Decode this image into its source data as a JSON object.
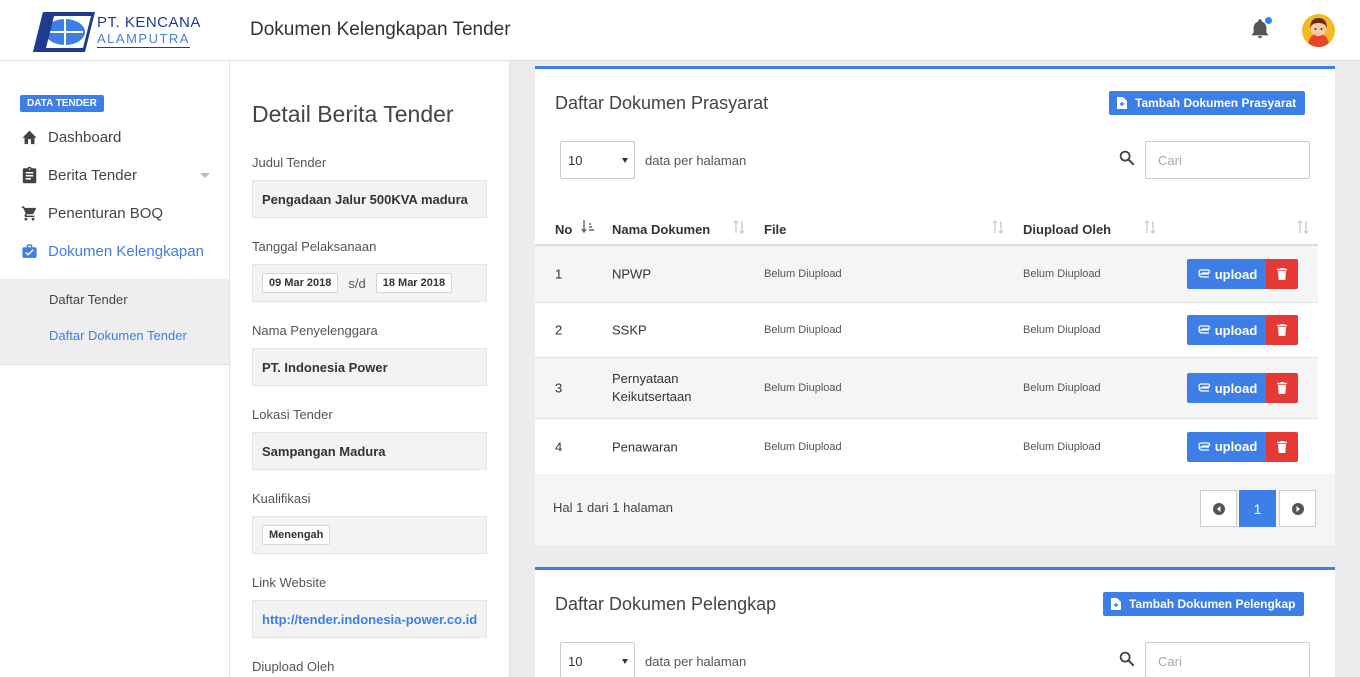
{
  "header": {
    "logo_line1": "PT. KENCANA",
    "logo_line2": "ALAMPUTRA",
    "page_title": "Dokumen Kelengkapan Tender"
  },
  "sidebar": {
    "section_label": "DATA TENDER",
    "items": [
      {
        "label": "Dashboard",
        "icon": "home-icon"
      },
      {
        "label": "Berita Tender",
        "icon": "clipboard-icon"
      },
      {
        "label": "Penenturan BOQ",
        "icon": "cart-icon"
      },
      {
        "label": "Dokumen Kelengkapan",
        "icon": "briefcase-check-icon"
      }
    ],
    "sub_items": [
      "Daftar Tender",
      "Daftar Dokumen Tender"
    ]
  },
  "detail": {
    "title": "Detail Berita Tender",
    "judul_label": "Judul Tender",
    "judul_value": "Pengadaan Jalur 500KVA madura",
    "tanggal_label": "Tanggal Pelaksanaan",
    "tanggal_start": "09 Mar 2018",
    "tanggal_sep": "s/d",
    "tanggal_end": "18 Mar 2018",
    "penyelenggara_label": "Nama Penyelenggara",
    "penyelenggara_value": "PT. Indonesia Power",
    "lokasi_label": "Lokasi Tender",
    "lokasi_value": "Sampangan Madura",
    "kualifikasi_label": "Kualifikasi",
    "kualifikasi_value": "Menengah",
    "link_label": "Link Website",
    "link_value": "http://tender.indonesia-power.co.id",
    "diupload_label": "Diupload Oleh"
  },
  "prasyarat": {
    "title": "Daftar Dokumen Prasyarat",
    "add_label": "Tambah Dokumen Prasyarat",
    "page_size": "10",
    "per_page_label": "data per halaman",
    "search_placeholder": "Cari",
    "columns": {
      "no": "No",
      "nama": "Nama Dokumen",
      "file": "File",
      "oleh": "Diupload Oleh"
    },
    "rows": [
      {
        "no": "1",
        "nama": "NPWP",
        "file": "Belum Diupload",
        "oleh": "Belum Diupload"
      },
      {
        "no": "2",
        "nama": "SSKP",
        "file": "Belum Diupload",
        "oleh": "Belum Diupload"
      },
      {
        "no": "3",
        "nama": "Pernyataan Keikutsertaan",
        "file": "Belum Diupload",
        "oleh": "Belum Diupload"
      },
      {
        "no": "4",
        "nama": "Penawaran",
        "file": "Belum Diupload",
        "oleh": "Belum Diupload"
      }
    ],
    "upload_label": "upload",
    "page_info": "Hal 1 dari 1 halaman",
    "current_page": "1"
  },
  "pelengkap": {
    "title": "Daftar Dokumen Pelengkap",
    "add_label": "Tambah Dokumen Pelengkap",
    "page_size": "10",
    "per_page_label": "data per halaman",
    "search_placeholder": "Cari"
  },
  "colors": {
    "accent": "#3d7fe6",
    "danger": "#e53935",
    "avatar_bg": "#f5b921"
  }
}
